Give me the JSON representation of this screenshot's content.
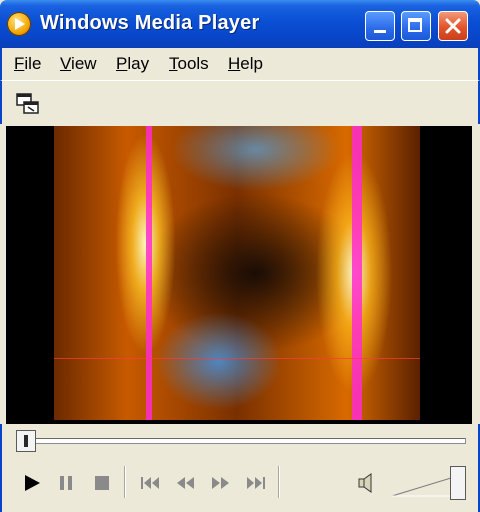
{
  "window": {
    "title": "Windows Media Player"
  },
  "menu": {
    "items": [
      {
        "first": "F",
        "rest": "ile"
      },
      {
        "first": "V",
        "rest": "iew"
      },
      {
        "first": "P",
        "rest": "lay"
      },
      {
        "first": "T",
        "rest": "ools"
      },
      {
        "first": "H",
        "rest": "elp"
      }
    ]
  },
  "icons": {
    "app": "windows-media-player-icon",
    "minimize": "minimize-icon",
    "maximize": "maximize-icon",
    "close": "close-icon",
    "compact_mode": "switch-to-skin-mode-icon",
    "play": "play-icon",
    "pause": "pause-icon",
    "stop": "stop-icon",
    "previous": "previous-track-icon",
    "rewind": "rewind-icon",
    "fast_forward": "fast-forward-icon",
    "next": "next-track-icon",
    "mute": "speaker-icon"
  },
  "playback": {
    "seek_position": 0.0,
    "volume": 1.0
  },
  "colors": {
    "titlebar": "#0845c8",
    "close_button": "#e3542a",
    "face": "#ece9d8",
    "streak": "#ff2bd0"
  }
}
